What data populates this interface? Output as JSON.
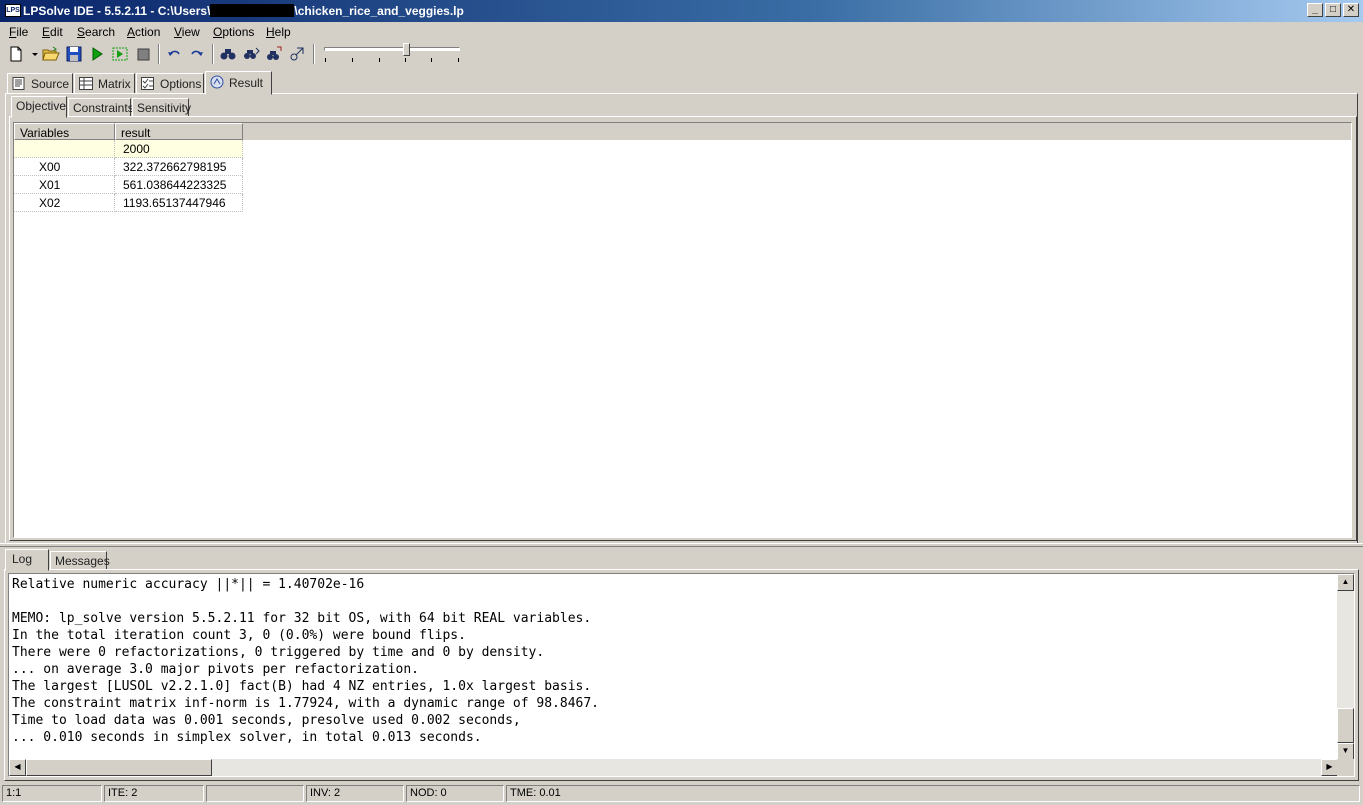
{
  "window": {
    "title_prefix": "LPSolve IDE - 5.5.2.11 - C:\\Users\\",
    "title_suffix": "\\chicken_rice_and_veggies.lp",
    "app_icon_text": "LPS",
    "minimize": "_",
    "maximize": "□",
    "close": "✕"
  },
  "menu": [
    "File",
    "Edit",
    "Search",
    "Action",
    "View",
    "Options",
    "Help"
  ],
  "toolbar_icons": [
    "new-file-icon",
    "dropdown-arrow-icon",
    "open-folder-icon",
    "save-icon",
    "run-icon",
    "step-icon",
    "stop-icon",
    "undo-icon",
    "redo-icon",
    "find-icon",
    "find-next-icon",
    "replace-icon",
    "goto-icon"
  ],
  "main_tabs": [
    {
      "label": "Source",
      "icon": "source-icon"
    },
    {
      "label": "Matrix",
      "icon": "matrix-icon"
    },
    {
      "label": "Options",
      "icon": "options-icon"
    },
    {
      "label": "Result",
      "icon": "result-icon",
      "active": true
    }
  ],
  "result_tabs": [
    {
      "label": "Objective",
      "active": true
    },
    {
      "label": "Constraints"
    },
    {
      "label": "Sensitivity"
    }
  ],
  "grid": {
    "headers": [
      "Variables",
      "result"
    ],
    "rows": [
      {
        "name": "",
        "value": "2000"
      },
      {
        "name": "X00",
        "value": "322.372662798195"
      },
      {
        "name": "X01",
        "value": "561.038644223325"
      },
      {
        "name": "X02",
        "value": "1193.65137447946"
      }
    ]
  },
  "bottom_tabs": [
    {
      "label": "Log",
      "active": true
    },
    {
      "label": "Messages"
    }
  ],
  "log_lines": [
    "Relative numeric accuracy ||*|| = 1.40702e-16",
    "",
    "MEMO: lp_solve version 5.5.2.11 for 32 bit OS, with 64 bit REAL variables.",
    "In the total iteration count 3, 0 (0.0%) were bound flips.",
    "There were 0 refactorizations, 0 triggered by time and 0 by density.",
    "... on average 3.0 major pivots per refactorization.",
    "The largest [LUSOL v2.2.1.0] fact(B) had 4 NZ entries, 1.0x largest basis.",
    "The constraint matrix inf-norm is 1.77924, with a dynamic range of 98.8467.",
    "Time to load data was 0.001 seconds, presolve used 0.002 seconds,",
    "... 0.010 seconds in simplex solver, in total 0.013 seconds."
  ],
  "status": [
    "1:1",
    "ITE: 2",
    "",
    "INV: 2",
    "NOD: 0",
    "TME: 0.01"
  ],
  "colors": {
    "title_active": "#0a246a",
    "face": "#d4d0c8",
    "selected_row": "#ffffe1"
  }
}
